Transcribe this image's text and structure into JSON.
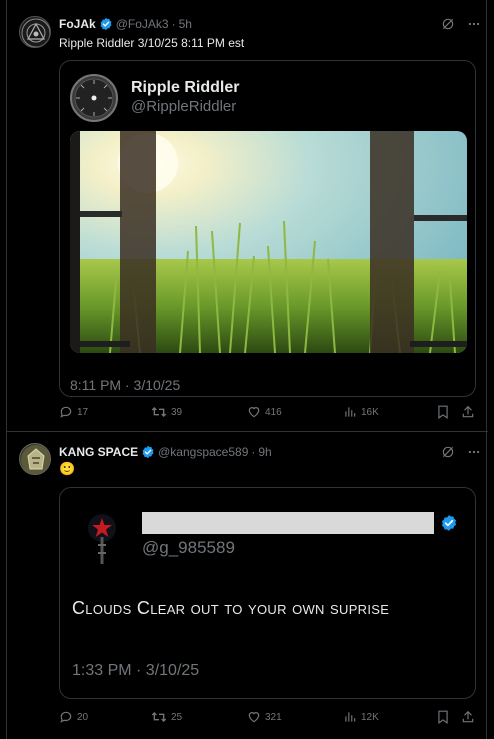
{
  "posts": [
    {
      "author_name": "FoJAk",
      "author_handle": "@FoJAk3",
      "separator": "·",
      "time": "5h",
      "text": "Ripple Riddler  3/10/25  8:11 PM est",
      "quoted": {
        "name": "Ripple Riddler",
        "handle": "@RippleRiddler",
        "timestamp": "8:11 PM · 3/10/25"
      },
      "stats": {
        "replies": "17",
        "reposts": "39",
        "likes": "416",
        "views": "16K"
      }
    },
    {
      "author_name": "KANG SPACE",
      "author_handle": "@kangspace589",
      "separator": "·",
      "time": "9h",
      "text": "🙂",
      "quoted": {
        "name": "",
        "handle": "@g_985589",
        "body": "Clouds Clear out to your own suprise",
        "timestamp": "1:33 PM · 3/10/25"
      },
      "stats": {
        "replies": "20",
        "reposts": "25",
        "likes": "321",
        "views": "12K"
      }
    }
  ],
  "colors": {
    "background": "#000000",
    "border": "#2f3336",
    "text": "#e7e9ea",
    "muted": "#71767b",
    "verified": "#1d9bf0"
  }
}
